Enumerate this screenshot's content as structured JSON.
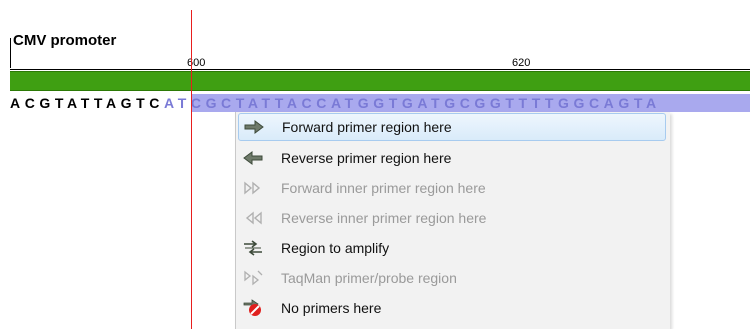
{
  "annotation": {
    "label": "CMV promoter"
  },
  "ruler": {
    "labels": [
      "600",
      "620"
    ]
  },
  "sequence": {
    "unselected": "ACGTATTAGTC",
    "selected": "ATCGCTATTACCATGGTGATGCGGTTTTGGCAGTA"
  },
  "context_menu": {
    "items": [
      {
        "label": "Forward primer region here",
        "icon": "forward-arrow-icon",
        "enabled": true,
        "highlighted": true
      },
      {
        "label": "Reverse primer region here",
        "icon": "reverse-arrow-icon",
        "enabled": true,
        "highlighted": false
      },
      {
        "label": "Forward inner primer region here",
        "icon": "forward-inner-icon",
        "enabled": false,
        "highlighted": false
      },
      {
        "label": "Reverse inner primer region here",
        "icon": "reverse-inner-icon",
        "enabled": false,
        "highlighted": false
      },
      {
        "label": "Region to amplify",
        "icon": "amplify-region-icon",
        "enabled": true,
        "highlighted": false
      },
      {
        "label": "TaqMan primer/probe region",
        "icon": "taqman-icon",
        "enabled": false,
        "highlighted": false
      },
      {
        "label": "No primers here",
        "icon": "no-primers-icon",
        "enabled": true,
        "highlighted": false
      }
    ]
  },
  "colors": {
    "track": "#3f9f12",
    "selection": "#a9a9ee",
    "cursor": "#e81e1e",
    "menu_background": "#f2f2f2",
    "disabled_text": "#9a9a9a"
  }
}
